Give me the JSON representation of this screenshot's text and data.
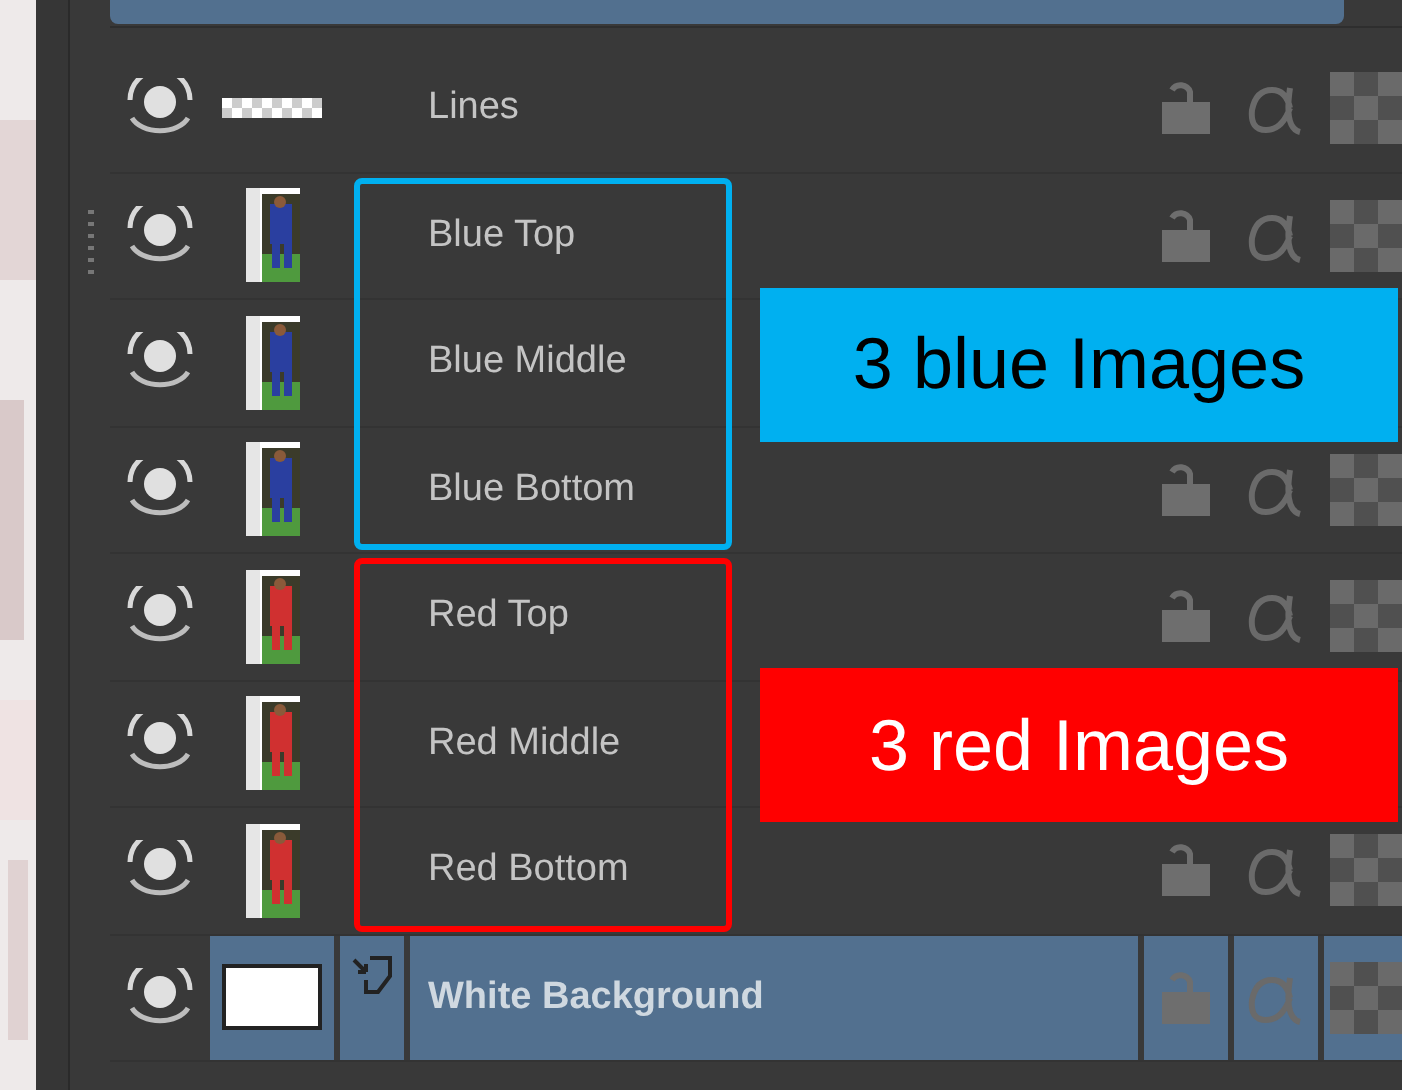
{
  "layers": [
    {
      "name": "Lines",
      "kind": "strip",
      "visible": true,
      "selected": false
    },
    {
      "name": "Blue Top",
      "color": "#2a3fa0",
      "visible": true,
      "selected": false
    },
    {
      "name": "Blue Middle",
      "color": "#2a3fa0",
      "visible": true,
      "selected": false
    },
    {
      "name": "Blue Bottom",
      "color": "#2a3fa0",
      "visible": true,
      "selected": false
    },
    {
      "name": "Red Top",
      "color": "#d03030",
      "visible": true,
      "selected": false
    },
    {
      "name": "Red Middle",
      "color": "#d03030",
      "visible": true,
      "selected": false
    },
    {
      "name": "Red Bottom",
      "color": "#d03030",
      "visible": true,
      "selected": false
    },
    {
      "name": "White Background",
      "kind": "background",
      "visible": true,
      "selected": true
    }
  ],
  "annotations": [
    {
      "text": "3 blue Images",
      "color": "#00b0f0"
    },
    {
      "text": "3 red Images",
      "color": "#ff0000"
    }
  ]
}
